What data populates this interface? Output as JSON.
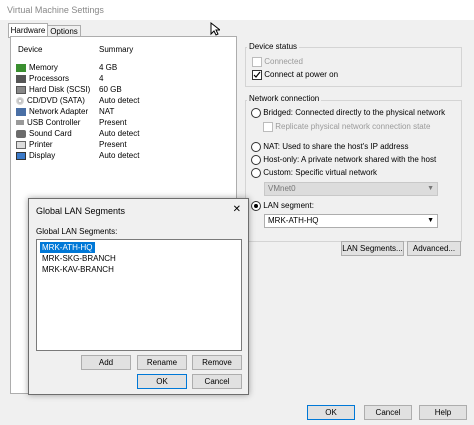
{
  "window": {
    "title": "Virtual Machine Settings"
  },
  "tabs": [
    {
      "label": "Hardware"
    },
    {
      "label": "Options"
    }
  ],
  "device_table": {
    "col_device": "Device",
    "col_summary": "Summary",
    "rows": [
      {
        "device": "Memory",
        "summary": "4 GB",
        "icon": "memory-icon"
      },
      {
        "device": "Processors",
        "summary": "4",
        "icon": "processor-icon"
      },
      {
        "device": "Hard Disk (SCSI)",
        "summary": "60 GB",
        "icon": "hard-disk-icon"
      },
      {
        "device": "CD/DVD (SATA)",
        "summary": "Auto detect",
        "icon": "cd-dvd-icon"
      },
      {
        "device": "Network Adapter",
        "summary": "NAT",
        "icon": "network-adapter-icon"
      },
      {
        "device": "USB Controller",
        "summary": "Present",
        "icon": "usb-icon"
      },
      {
        "device": "Sound Card",
        "summary": "Auto detect",
        "icon": "sound-card-icon"
      },
      {
        "device": "Printer",
        "summary": "Present",
        "icon": "printer-icon"
      },
      {
        "device": "Display",
        "summary": "Auto detect",
        "icon": "display-icon"
      }
    ]
  },
  "device_status": {
    "label": "Device status",
    "connected": {
      "label": "Connected",
      "checked": false,
      "enabled": false
    },
    "connect_at_power_on": {
      "label": "Connect at power on",
      "checked": true
    }
  },
  "network_connection": {
    "label": "Network connection",
    "bridged": "Bridged: Connected directly to the physical network",
    "replicate": "Replicate physical network connection state",
    "nat": "NAT: Used to share the host's IP address",
    "host_only": "Host-only: A private network shared with the host",
    "custom": "Custom: Specific virtual network",
    "custom_value": "VMnet0",
    "lan_segment": "LAN segment:",
    "lan_segment_value": "MRK-ATH-HQ",
    "selected": "lan_segment"
  },
  "buttons": {
    "lan_segments": "LAN Segments...",
    "advanced": "Advanced...",
    "ok": "OK",
    "cancel": "Cancel",
    "help": "Help"
  },
  "dialog": {
    "title": "Global LAN Segments",
    "close": "✕",
    "list_label": "Global LAN Segments:",
    "items": [
      "MRK-ATH-HQ",
      "MRK-SKG-BRANCH",
      "MRK-KAV-BRANCH"
    ],
    "selected_index": 0,
    "add": "Add",
    "rename": "Rename",
    "remove": "Remove",
    "ok": "OK",
    "cancel": "Cancel"
  },
  "colors": {
    "accent": "#0078d7",
    "window_bg": "#f0f0f0"
  }
}
